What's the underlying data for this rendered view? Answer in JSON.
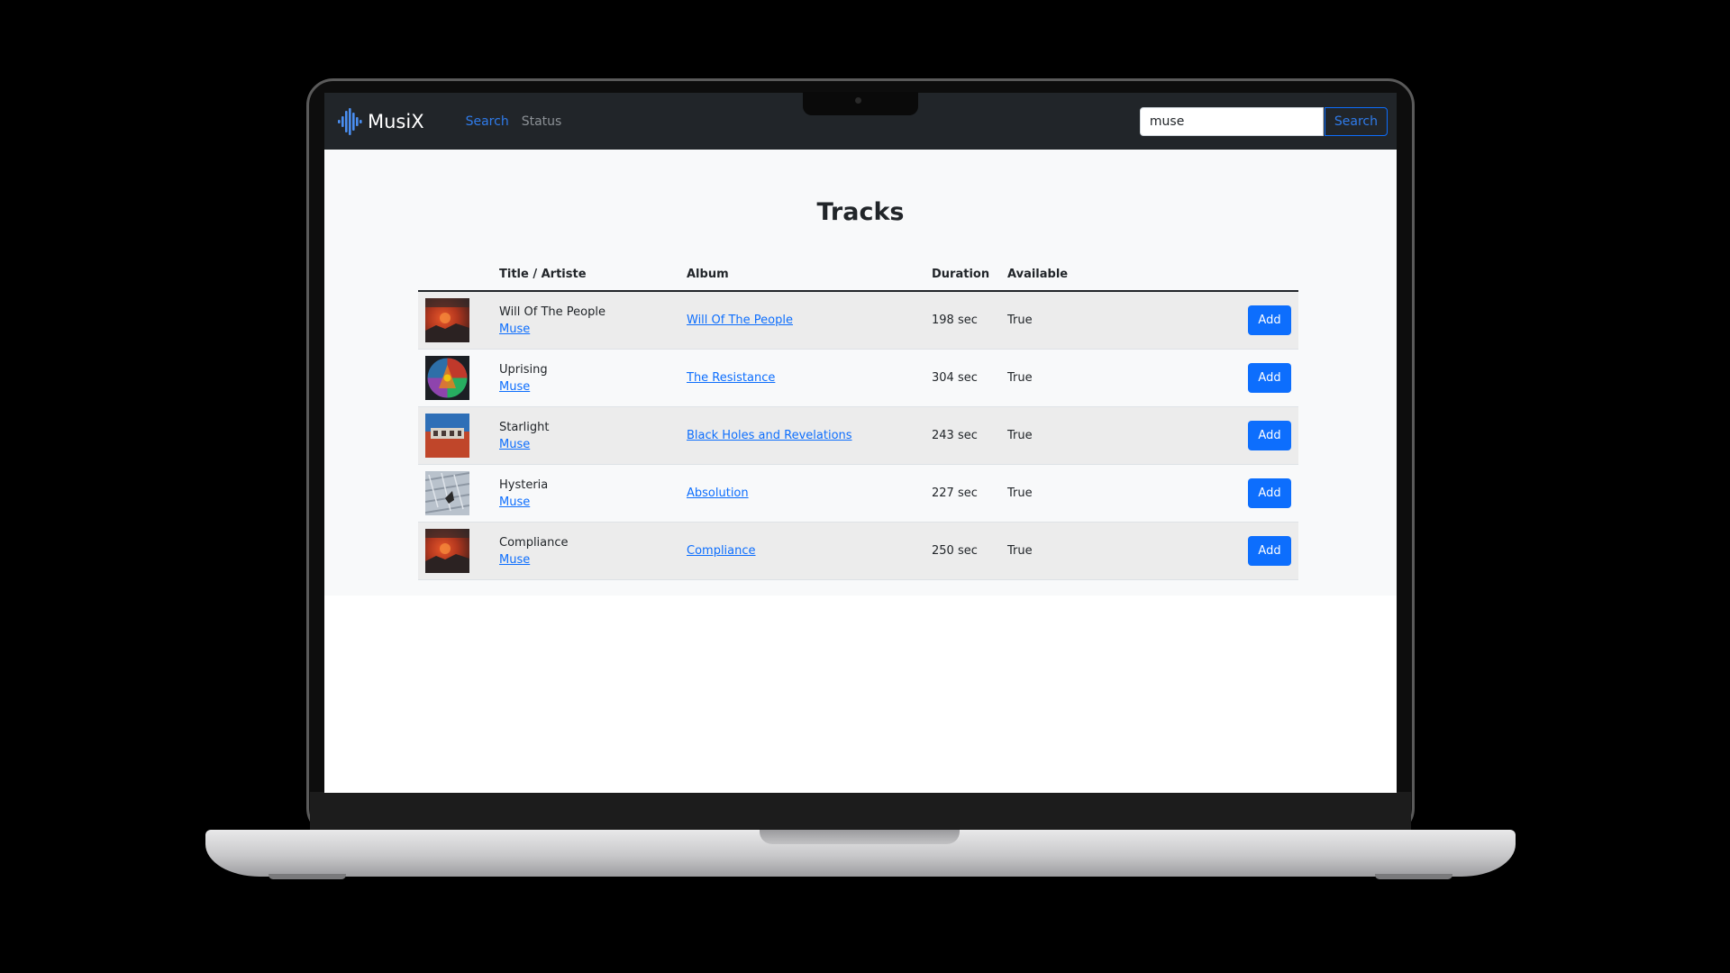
{
  "app": {
    "brand": "MusiX",
    "accent": "#0d6efd",
    "nav": [
      {
        "label": "Search",
        "active": true
      },
      {
        "label": "Status",
        "active": false
      }
    ],
    "search": {
      "value": "muse",
      "button_label": "Search"
    }
  },
  "page": {
    "title": "Tracks",
    "columns": [
      "",
      "Title / Artiste",
      "Album",
      "Duration",
      "Available",
      ""
    ],
    "rows": [
      {
        "title": "Will Of The People",
        "artist": "Muse",
        "album": "Will Of The People",
        "duration": "198 sec",
        "available": "True",
        "button": "Add",
        "cover": "will-of-the-people-cover"
      },
      {
        "title": "Uprising",
        "artist": "Muse",
        "album": "The Resistance",
        "duration": "304 sec",
        "available": "True",
        "button": "Add",
        "cover": "the-resistance-cover"
      },
      {
        "title": "Starlight",
        "artist": "Muse",
        "album": "Black Holes and Revelations",
        "duration": "243 sec",
        "available": "True",
        "button": "Add",
        "cover": "black-holes-cover"
      },
      {
        "title": "Hysteria",
        "artist": "Muse",
        "album": "Absolution",
        "duration": "227 sec",
        "available": "True",
        "button": "Add",
        "cover": "absolution-cover"
      },
      {
        "title": "Compliance",
        "artist": "Muse",
        "album": "Compliance",
        "duration": "250 sec",
        "available": "True",
        "button": "Add",
        "cover": "compliance-cover"
      }
    ]
  }
}
